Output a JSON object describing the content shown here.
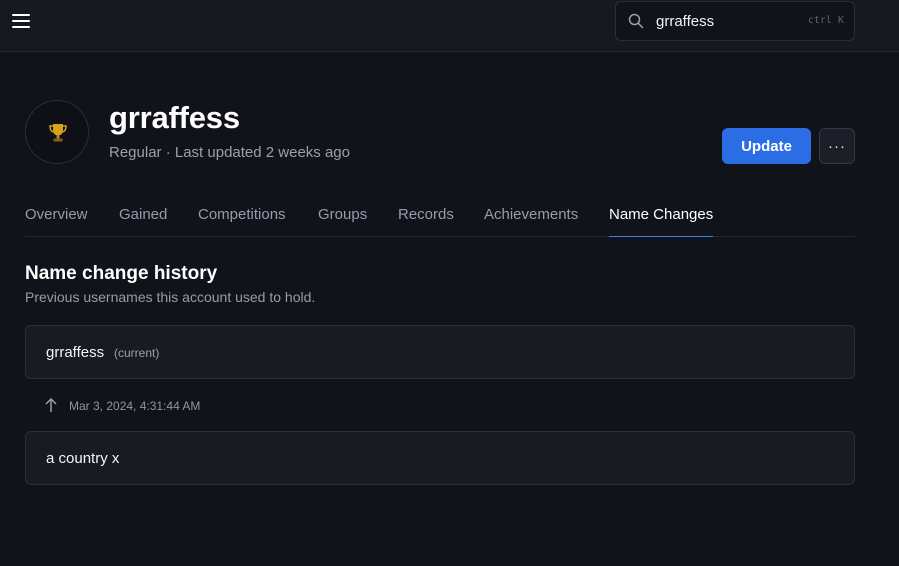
{
  "topbar": {
    "menu_icon": "hamburger-menu-icon",
    "search": {
      "icon": "search-icon",
      "value": "grraffess",
      "shortcut": "ctrl K"
    }
  },
  "player": {
    "name": "grraffess",
    "meta": "Regular · Last updated 2 weeks ago",
    "avatar_icon": "trophy-icon",
    "update_label": "Update",
    "more_label": "···"
  },
  "tabs": [
    {
      "label": "Overview",
      "active": false
    },
    {
      "label": "Gained",
      "active": false
    },
    {
      "label": "Competitions",
      "active": false
    },
    {
      "label": "Groups",
      "active": false
    },
    {
      "label": "Records",
      "active": false
    },
    {
      "label": "Achievements",
      "active": false
    },
    {
      "label": "Name Changes",
      "active": true
    }
  ],
  "history": {
    "title": "Name change history",
    "description": "Previous usernames this account used to hold.",
    "entries": [
      {
        "name": "grraffess",
        "tag": "(current)"
      },
      {
        "name": "a country x",
        "tag": ""
      }
    ],
    "changes": [
      {
        "date": "Mar 3, 2024, 4:31:44 AM",
        "icon": "arrow-up-icon"
      }
    ]
  },
  "colors": {
    "background": "#11131a",
    "topbar": "#161920",
    "accent": "#2b6de5",
    "active_tab_underline": "#3b82f6",
    "card": "#181b22"
  }
}
